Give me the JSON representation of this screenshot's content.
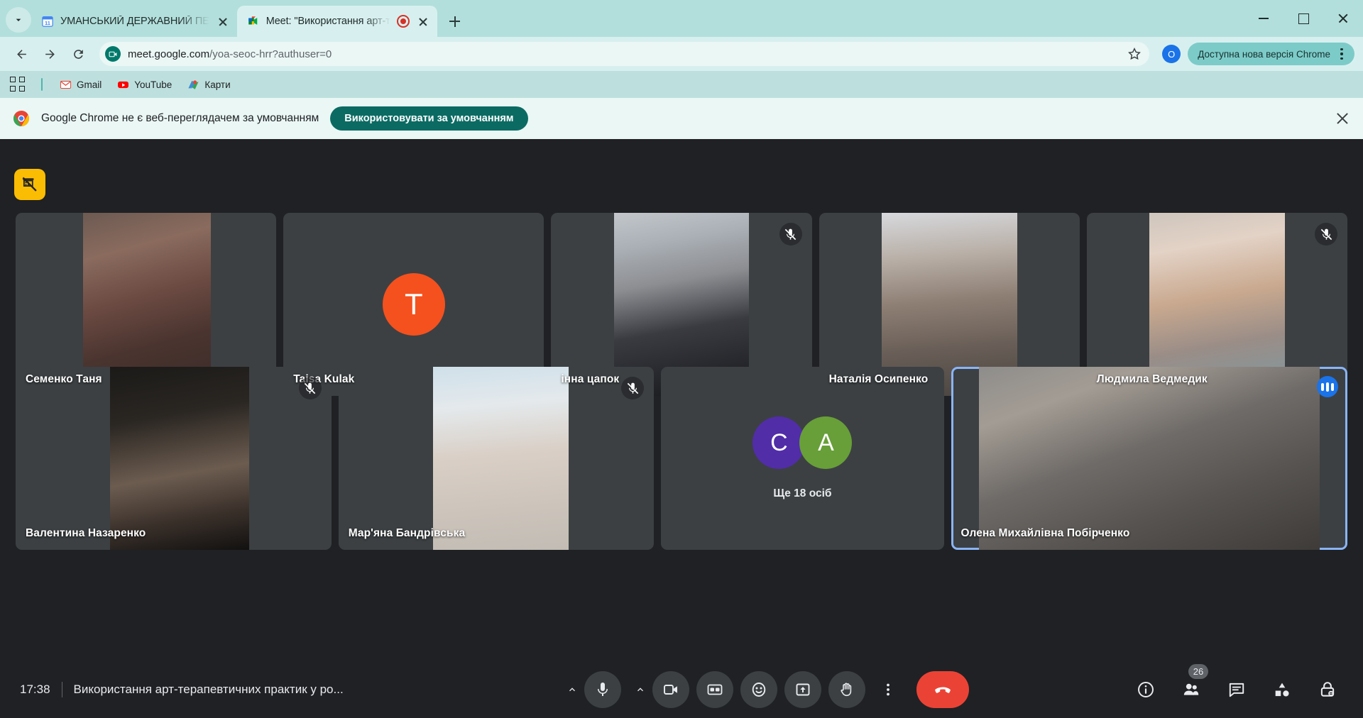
{
  "browser": {
    "tabs": [
      {
        "title": "УМАНСЬКИЙ ДЕРЖАВНИЙ ПЕ",
        "favicon": "calendar-icon",
        "active": false,
        "recording": false
      },
      {
        "title": "Meet: \"Використання арт-т",
        "favicon": "meet-icon",
        "active": true,
        "recording": true
      }
    ],
    "toolbar": {
      "url_main": "meet.google.com",
      "url_path": "/yoa-seoc-hrr?authuser=0",
      "profile_initial": "O",
      "update_label": "Доступна нова версія Chrome"
    },
    "bookmarks": [
      {
        "label": "Gmail",
        "icon": "gmail-icon"
      },
      {
        "label": "YouTube",
        "icon": "youtube-icon"
      },
      {
        "label": "Карти",
        "icon": "maps-icon"
      }
    ],
    "infobar": {
      "message": "Google Chrome не є веб-переглядачем за умовчанням",
      "cta": "Використовувати за умовчанням"
    }
  },
  "meet": {
    "share_badge": "presentation-off-icon",
    "participants_row1": [
      {
        "name": "Семенко Таня",
        "muted": false,
        "speaking": false,
        "kind": "video",
        "video_left": "26%",
        "video_width": "49%",
        "video_grad": "linear-gradient(165deg,#6d5a52 0%,#8a6b5e 22%,#6b4a42 46%,#4a342f 70%,#3a2a27 100%)"
      },
      {
        "name": "Taisa Kulak",
        "muted": false,
        "speaking": false,
        "kind": "avatar",
        "avatar_letter": "T",
        "avatar_color": "#f4511e"
      },
      {
        "name": "інна цапок",
        "muted": true,
        "speaking": false,
        "kind": "video",
        "video_left": "24%",
        "video_width": "52%",
        "video_grad": "linear-gradient(170deg,#c3c7cc 0%,#aab0b6 18%,#8d8e92 38%,#3a3b41 62%,#17181c 100%)"
      },
      {
        "name": "Наталія Осипенко",
        "muted": false,
        "speaking": false,
        "kind": "video",
        "video_left": "24%",
        "video_width": "52%",
        "video_grad": "linear-gradient(175deg,#d7d9dd 0%,#b9b0a8 24%,#8e7f74 48%,#6a5f58 72%,#4a4440 100%)"
      },
      {
        "name": "Людмила Ведмедик",
        "muted": true,
        "speaking": false,
        "kind": "video",
        "video_left": "24%",
        "video_width": "52%",
        "video_grad": "linear-gradient(170deg,#cfc6bd 0%,#e3d2c6 20%,#c9a98f 46%,#9a8d87 70%,#7e9aa2 100%)"
      }
    ],
    "participants_row2": [
      {
        "name": "Валентина Назаренко",
        "muted": true,
        "speaking": false,
        "kind": "video",
        "video_left": "30%",
        "video_width": "44%",
        "video_grad": "linear-gradient(170deg,#1b1a18 0%,#2a2622 28%,#6c5c50 58%,#3a302a 80%,#121110 100%)"
      },
      {
        "name": "Мар'яна Бандрівська",
        "muted": true,
        "speaking": false,
        "kind": "video",
        "video_left": "30%",
        "video_width": "43%",
        "video_grad": "linear-gradient(175deg,#cfe0ea 0%,#e4e9ec 22%,#d9cfc6 48%,#cfc6bd 70%,#c2bcb4 100%)"
      },
      {
        "kind": "overflow",
        "overflow_text": "Ще 18 осіб",
        "overflow_avatars": [
          {
            "letter": "C",
            "color": "#512da8"
          },
          {
            "letter": "A",
            "color": "#689f38"
          }
        ]
      },
      {
        "name": "Олена Михайлівна Побірченко",
        "muted": false,
        "speaking": true,
        "kind": "video",
        "video_left": "7%",
        "video_width": "86%",
        "video_grad": "linear-gradient(160deg,#8e8d8b 0%,#a39c94 20%,#6f6b68 45%,#565350 70%,#3e3b39 100%)"
      }
    ],
    "bottom": {
      "time": "17:38",
      "meeting_title": "Використання арт-терапевтичних практик у ро...",
      "controls": [
        {
          "name": "microphone",
          "icon": "mic-icon"
        },
        {
          "name": "camera",
          "icon": "camera-icon"
        },
        {
          "name": "captions",
          "icon": "cc-icon"
        },
        {
          "name": "reactions",
          "icon": "emoji-icon"
        },
        {
          "name": "present",
          "icon": "present-icon"
        },
        {
          "name": "raise-hand",
          "icon": "hand-icon"
        },
        {
          "name": "more-options",
          "icon": "more-vert-icon"
        },
        {
          "name": "leave-call",
          "icon": "call-end-icon"
        }
      ],
      "right_icons": [
        {
          "name": "meeting-details",
          "icon": "info-icon",
          "badge": ""
        },
        {
          "name": "people",
          "icon": "people-icon",
          "badge": "26"
        },
        {
          "name": "chat",
          "icon": "chat-icon",
          "badge": ""
        },
        {
          "name": "activities",
          "icon": "activities-icon",
          "badge": ""
        },
        {
          "name": "host-controls",
          "icon": "lock-icon",
          "badge": ""
        }
      ]
    }
  }
}
